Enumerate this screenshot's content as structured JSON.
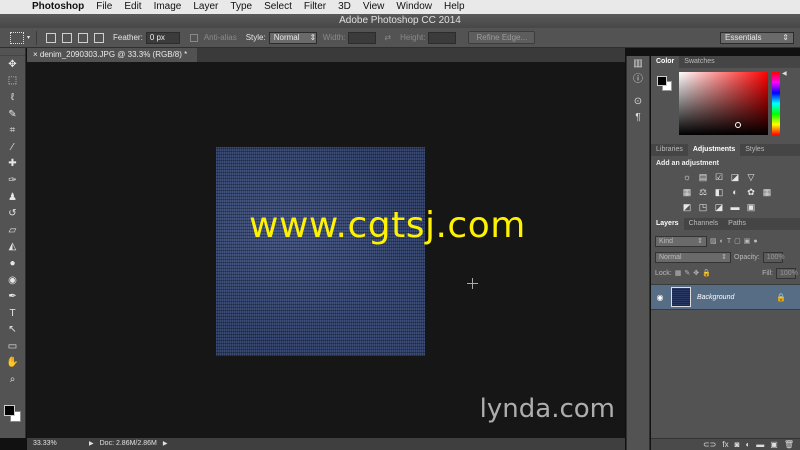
{
  "menubar": {
    "items": [
      "Photoshop",
      "File",
      "Edit",
      "Image",
      "Layer",
      "Type",
      "Select",
      "Filter",
      "3D",
      "View",
      "Window",
      "Help"
    ]
  },
  "window": {
    "title": "Adobe Photoshop CC 2014"
  },
  "options_bar": {
    "feather_label": "Feather:",
    "feather_value": "0 px",
    "antialias_label": "Anti-alias",
    "style_label": "Style:",
    "style_value": "Normal",
    "width_label": "Width:",
    "height_label": "Height:",
    "refine_edge": "Refine Edge...",
    "workspace": "Essentials"
  },
  "document": {
    "tab_title": "denim_2090303.JPG @ 33.3% (RGB/8) *"
  },
  "overlay": {
    "watermark": "www.cgtsj.com",
    "brand": "lynda.com"
  },
  "status": {
    "zoom": "33.33%",
    "doc_size": "Doc: 2.86M/2.86M"
  },
  "color_panel": {
    "tabs": [
      "Color",
      "Swatches"
    ],
    "foreground": "#000000",
    "background": "#ffffff"
  },
  "adjustments_panel": {
    "tabs": [
      "Libraries",
      "Adjustments",
      "Styles"
    ],
    "heading": "Add an adjustment"
  },
  "layers_panel": {
    "tabs": [
      "Layers",
      "Channels",
      "Paths"
    ],
    "kind": "Kind",
    "blend_mode": "Normal",
    "opacity_label": "Opacity:",
    "opacity_value": "100%",
    "lock_label": "Lock:",
    "fill_label": "Fill:",
    "fill_value": "100%",
    "layers": [
      {
        "name": "Background",
        "visible": true,
        "locked": true
      }
    ]
  },
  "colors": {
    "accent_selected_layer": "#576c85",
    "watermark": "#fff200",
    "denim": "#283862"
  }
}
